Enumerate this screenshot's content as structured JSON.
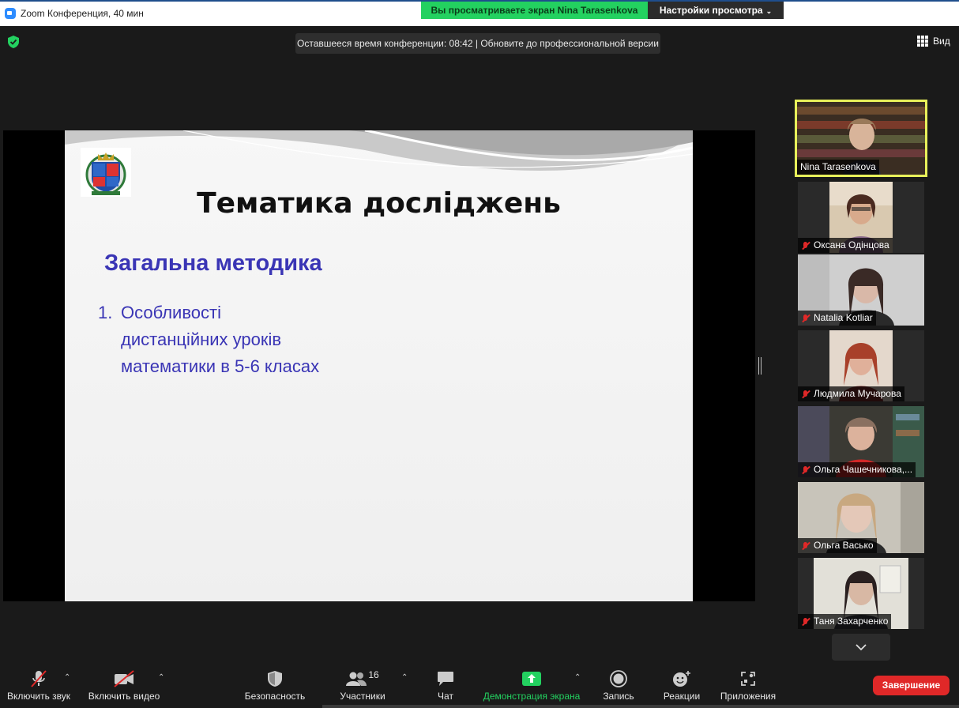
{
  "window": {
    "title": "Zoom Конференция, 40 мин",
    "share_banner": "Вы просматриваете экран Nina Tarasenkova",
    "view_options": "Настройки просмотра"
  },
  "header": {
    "time_notice": "Оставшееся время конференции: 08:42 | Обновите до профессиональной версии",
    "view_label": "Вид"
  },
  "slide": {
    "title": "Тематика досліджень",
    "subtitle": "Загальна методика",
    "item_number": "1.",
    "item_lines": [
      "Особливості",
      "дистанційних уроків",
      "математики в 5-6 класах"
    ]
  },
  "participants": [
    {
      "name": "Nina Tarasenkova",
      "muted": false,
      "active": true,
      "bg": "#4a3b2e"
    },
    {
      "name": "Оксана Одінцова",
      "muted": true,
      "active": false,
      "bg": "#b9a58e"
    },
    {
      "name": "Natalia Kotliar",
      "muted": true,
      "active": false,
      "bg": "#c8c6c4"
    },
    {
      "name": "Людмила Мучарова",
      "muted": true,
      "active": false,
      "bg": "#d9cbbf"
    },
    {
      "name": "Ольга Чашечникова,...",
      "muted": true,
      "active": false,
      "bg": "#5a4a3a"
    },
    {
      "name": "Ольга Васько",
      "muted": true,
      "active": false,
      "bg": "#c9c3b6"
    },
    {
      "name": "Таня Захарченко",
      "muted": true,
      "active": false,
      "bg": "#d6d2c8"
    }
  ],
  "toolbar": {
    "unmute": "Включить звук",
    "start_video": "Включить видео",
    "security": "Безопасность",
    "participants": "Участники",
    "participants_count": "16",
    "chat": "Чат",
    "share_screen": "Демонстрация экрана",
    "record": "Запись",
    "reactions": "Реакции",
    "apps": "Приложения",
    "end": "Завершение"
  },
  "colors": {
    "share_banner": "#23d160",
    "end_button": "#e02828",
    "active_speaker_border": "#e8f05a",
    "slide_text": "#3a35b5"
  }
}
